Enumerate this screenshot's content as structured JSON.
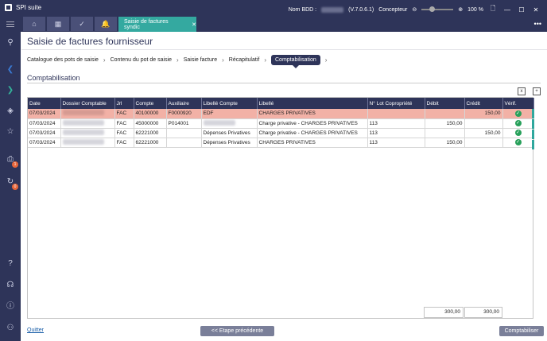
{
  "app": {
    "title": "SPI suite",
    "db_label": "Nom BDD :",
    "version": "(V.7.0.6.1)",
    "role": "Concepteur",
    "zoom": "100 %"
  },
  "tab": {
    "label": "Saisie de factures syndic",
    "close": "✕"
  },
  "page": {
    "title": "Saisie de factures fournisseur"
  },
  "breadcrumb": [
    {
      "label": "Catalogue des pots de saisie"
    },
    {
      "label": "Contenu du pot de saisie"
    },
    {
      "label": "Saisie facture"
    },
    {
      "label": "Récapitulatif"
    },
    {
      "label": "Comptabilisation"
    }
  ],
  "section": {
    "title": "Comptabilisation"
  },
  "table": {
    "columns": [
      "Date",
      "Dossier Comptable",
      "Jrl",
      "Compte",
      "Auxiliaire",
      "Libellé Compte",
      "Libellé",
      "N° Lot Copropriété",
      "Débit",
      "Crédit",
      "Vérif."
    ],
    "rows": [
      {
        "date": "07/03/2024",
        "jrl": "FAC",
        "compte": "40100000",
        "aux": "F0000920",
        "lib_compte": "EDF",
        "libelle": "CHARGES PRIVATIVES",
        "lot": "",
        "debit": "",
        "credit": "150,00",
        "selected": true
      },
      {
        "date": "07/03/2024",
        "jrl": "FAC",
        "compte": "45000000",
        "aux": "P014001",
        "lib_compte": "",
        "libelle": "Charge privative - CHARGES PRIVATIVES",
        "lot": "113",
        "debit": "150,00",
        "credit": "",
        "selected": false
      },
      {
        "date": "07/03/2024",
        "jrl": "FAC",
        "compte": "62221000",
        "aux": "",
        "lib_compte": "Dépenses Privatives",
        "libelle": "Charge privative - CHARGES PRIVATIVES",
        "lot": "113",
        "debit": "",
        "credit": "150,00",
        "selected": false
      },
      {
        "date": "07/03/2024",
        "jrl": "FAC",
        "compte": "62221000",
        "aux": "",
        "lib_compte": "Dépenses Privatives",
        "libelle": "CHARGES PRIVATIVES",
        "lot": "113",
        "debit": "150,00",
        "credit": "",
        "selected": false
      }
    ],
    "totals": {
      "debit": "300,00",
      "credit": "300,00"
    }
  },
  "footer": {
    "quit": "Quitter",
    "prev": "<< Etape précédente",
    "submit": "Comptabiliser"
  },
  "sidebar": {
    "badges": [
      "1",
      "0"
    ]
  }
}
